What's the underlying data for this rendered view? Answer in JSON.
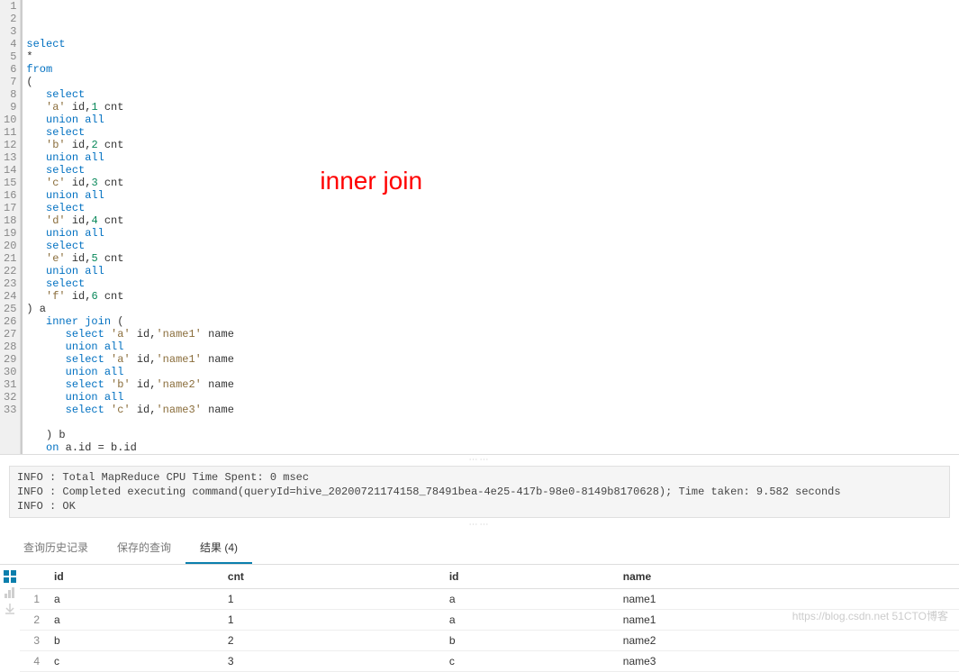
{
  "annotation": "inner join",
  "code_lines": [
    {
      "n": 1,
      "tokens": [
        {
          "t": "select",
          "c": "kw"
        }
      ]
    },
    {
      "n": 2,
      "tokens": [
        {
          "t": "*",
          "c": "ident"
        }
      ]
    },
    {
      "n": 3,
      "tokens": [
        {
          "t": "from",
          "c": "kw"
        }
      ]
    },
    {
      "n": 4,
      "tokens": [
        {
          "t": "(",
          "c": "ident"
        }
      ]
    },
    {
      "n": 5,
      "tokens": [
        {
          "t": "   ",
          "c": ""
        },
        {
          "t": "select",
          "c": "kw"
        }
      ]
    },
    {
      "n": 6,
      "tokens": [
        {
          "t": "   ",
          "c": ""
        },
        {
          "t": "'a'",
          "c": "str"
        },
        {
          "t": " id,",
          "c": "ident"
        },
        {
          "t": "1",
          "c": "num"
        },
        {
          "t": " cnt",
          "c": "ident"
        }
      ]
    },
    {
      "n": 7,
      "tokens": [
        {
          "t": "   ",
          "c": ""
        },
        {
          "t": "union",
          "c": "kw"
        },
        {
          "t": " ",
          "c": ""
        },
        {
          "t": "all",
          "c": "kw"
        }
      ]
    },
    {
      "n": 8,
      "tokens": [
        {
          "t": "   ",
          "c": ""
        },
        {
          "t": "select",
          "c": "kw"
        }
      ]
    },
    {
      "n": 9,
      "tokens": [
        {
          "t": "   ",
          "c": ""
        },
        {
          "t": "'b'",
          "c": "str"
        },
        {
          "t": " id,",
          "c": "ident"
        },
        {
          "t": "2",
          "c": "num"
        },
        {
          "t": " cnt",
          "c": "ident"
        }
      ]
    },
    {
      "n": 10,
      "tokens": [
        {
          "t": "   ",
          "c": ""
        },
        {
          "t": "union",
          "c": "kw"
        },
        {
          "t": " ",
          "c": ""
        },
        {
          "t": "all",
          "c": "kw"
        }
      ]
    },
    {
      "n": 11,
      "tokens": [
        {
          "t": "   ",
          "c": ""
        },
        {
          "t": "select",
          "c": "kw"
        }
      ]
    },
    {
      "n": 12,
      "tokens": [
        {
          "t": "   ",
          "c": ""
        },
        {
          "t": "'c'",
          "c": "str"
        },
        {
          "t": " id,",
          "c": "ident"
        },
        {
          "t": "3",
          "c": "num"
        },
        {
          "t": " cnt",
          "c": "ident"
        }
      ]
    },
    {
      "n": 13,
      "tokens": [
        {
          "t": "   ",
          "c": ""
        },
        {
          "t": "union",
          "c": "kw"
        },
        {
          "t": " ",
          "c": ""
        },
        {
          "t": "all",
          "c": "kw"
        }
      ]
    },
    {
      "n": 14,
      "tokens": [
        {
          "t": "   ",
          "c": ""
        },
        {
          "t": "select",
          "c": "kw"
        }
      ]
    },
    {
      "n": 15,
      "tokens": [
        {
          "t": "   ",
          "c": ""
        },
        {
          "t": "'d'",
          "c": "str"
        },
        {
          "t": " id,",
          "c": "ident"
        },
        {
          "t": "4",
          "c": "num"
        },
        {
          "t": " cnt",
          "c": "ident"
        }
      ]
    },
    {
      "n": 16,
      "tokens": [
        {
          "t": "   ",
          "c": ""
        },
        {
          "t": "union",
          "c": "kw"
        },
        {
          "t": " ",
          "c": ""
        },
        {
          "t": "all",
          "c": "kw"
        }
      ]
    },
    {
      "n": 17,
      "tokens": [
        {
          "t": "   ",
          "c": ""
        },
        {
          "t": "select",
          "c": "kw"
        }
      ]
    },
    {
      "n": 18,
      "tokens": [
        {
          "t": "   ",
          "c": ""
        },
        {
          "t": "'e'",
          "c": "str"
        },
        {
          "t": " id,",
          "c": "ident"
        },
        {
          "t": "5",
          "c": "num"
        },
        {
          "t": " cnt",
          "c": "ident"
        }
      ]
    },
    {
      "n": 19,
      "tokens": [
        {
          "t": "   ",
          "c": ""
        },
        {
          "t": "union",
          "c": "kw"
        },
        {
          "t": " ",
          "c": ""
        },
        {
          "t": "all",
          "c": "kw"
        }
      ]
    },
    {
      "n": 20,
      "tokens": [
        {
          "t": "   ",
          "c": ""
        },
        {
          "t": "select",
          "c": "kw"
        }
      ]
    },
    {
      "n": 21,
      "tokens": [
        {
          "t": "   ",
          "c": ""
        },
        {
          "t": "'f'",
          "c": "str"
        },
        {
          "t": " id,",
          "c": "ident"
        },
        {
          "t": "6",
          "c": "num"
        },
        {
          "t": " cnt",
          "c": "ident"
        }
      ]
    },
    {
      "n": 22,
      "tokens": [
        {
          "t": ") a",
          "c": "ident"
        }
      ]
    },
    {
      "n": 23,
      "tokens": [
        {
          "t": "   ",
          "c": ""
        },
        {
          "t": "inner",
          "c": "kw"
        },
        {
          "t": " ",
          "c": ""
        },
        {
          "t": "join",
          "c": "kw"
        },
        {
          "t": " (",
          "c": "ident"
        }
      ]
    },
    {
      "n": 24,
      "tokens": [
        {
          "t": "      ",
          "c": ""
        },
        {
          "t": "select",
          "c": "kw"
        },
        {
          "t": " ",
          "c": ""
        },
        {
          "t": "'a'",
          "c": "str"
        },
        {
          "t": " id,",
          "c": "ident"
        },
        {
          "t": "'name1'",
          "c": "str"
        },
        {
          "t": " name",
          "c": "ident"
        }
      ]
    },
    {
      "n": 25,
      "tokens": [
        {
          "t": "      ",
          "c": ""
        },
        {
          "t": "union",
          "c": "kw"
        },
        {
          "t": " ",
          "c": ""
        },
        {
          "t": "all",
          "c": "kw"
        }
      ]
    },
    {
      "n": 26,
      "tokens": [
        {
          "t": "      ",
          "c": ""
        },
        {
          "t": "select",
          "c": "kw"
        },
        {
          "t": " ",
          "c": ""
        },
        {
          "t": "'a'",
          "c": "str"
        },
        {
          "t": " id,",
          "c": "ident"
        },
        {
          "t": "'name1'",
          "c": "str"
        },
        {
          "t": " name",
          "c": "ident"
        }
      ]
    },
    {
      "n": 27,
      "tokens": [
        {
          "t": "      ",
          "c": ""
        },
        {
          "t": "union",
          "c": "kw"
        },
        {
          "t": " ",
          "c": ""
        },
        {
          "t": "all",
          "c": "kw"
        }
      ]
    },
    {
      "n": 28,
      "tokens": [
        {
          "t": "      ",
          "c": ""
        },
        {
          "t": "select",
          "c": "kw"
        },
        {
          "t": " ",
          "c": ""
        },
        {
          "t": "'b'",
          "c": "str"
        },
        {
          "t": " id,",
          "c": "ident"
        },
        {
          "t": "'name2'",
          "c": "str"
        },
        {
          "t": " name",
          "c": "ident"
        }
      ]
    },
    {
      "n": 29,
      "tokens": [
        {
          "t": "      ",
          "c": ""
        },
        {
          "t": "union",
          "c": "kw"
        },
        {
          "t": " ",
          "c": ""
        },
        {
          "t": "all",
          "c": "kw"
        }
      ]
    },
    {
      "n": 30,
      "tokens": [
        {
          "t": "      ",
          "c": ""
        },
        {
          "t": "select",
          "c": "kw"
        },
        {
          "t": " ",
          "c": ""
        },
        {
          "t": "'c'",
          "c": "str"
        },
        {
          "t": " id,",
          "c": "ident"
        },
        {
          "t": "'name3'",
          "c": "str"
        },
        {
          "t": " name",
          "c": "ident"
        }
      ]
    },
    {
      "n": 31,
      "tokens": [
        {
          "t": "",
          "c": ""
        }
      ]
    },
    {
      "n": 32,
      "tokens": [
        {
          "t": "   ) b",
          "c": "ident"
        }
      ]
    },
    {
      "n": 33,
      "tokens": [
        {
          "t": "   ",
          "c": ""
        },
        {
          "t": "on",
          "c": "kw"
        },
        {
          "t": " a.id = b.id",
          "c": "ident"
        }
      ]
    }
  ],
  "console": {
    "line1": "INFO  : Total MapReduce CPU Time Spent: 0 msec",
    "line2": "INFO  : Completed executing command(queryId=hive_20200721174158_78491bea-4e25-417b-98e0-8149b8170628); Time taken: 9.582 seconds",
    "line3": "INFO  : OK"
  },
  "tabs": {
    "history": "查询历史记录",
    "saved": "保存的查询",
    "results": "结果 (4)"
  },
  "columns": [
    "",
    "id",
    "cnt",
    "id",
    "name"
  ],
  "rows": [
    {
      "n": "1",
      "id": "a",
      "cnt": "1",
      "id2": "a",
      "name": "name1"
    },
    {
      "n": "2",
      "id": "a",
      "cnt": "1",
      "id2": "a",
      "name": "name1"
    },
    {
      "n": "3",
      "id": "b",
      "cnt": "2",
      "id2": "b",
      "name": "name2"
    },
    {
      "n": "4",
      "id": "c",
      "cnt": "3",
      "id2": "c",
      "name": "name3"
    }
  ],
  "watermark": "https://blog.csdn.net  51CTO博客"
}
